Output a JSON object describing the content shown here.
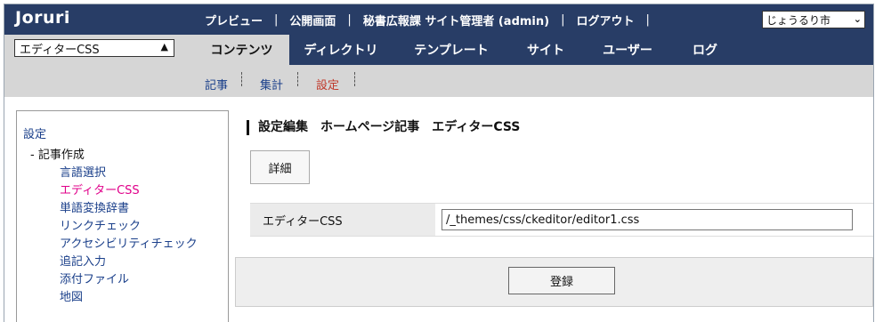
{
  "header": {
    "logo": "Joruri",
    "nav": {
      "preview": "プレビュー",
      "public": "公開画面",
      "user": "秘書広報課 サイト管理者 (admin)",
      "logout": "ログアウト",
      "sep": "|"
    },
    "site_select": "じょうるり市"
  },
  "menu_select": {
    "value": "エディターCSS"
  },
  "tabs": [
    "コンテンツ",
    "ディレクトリ",
    "テンプレート",
    "サイト",
    "ユーザー",
    "ログ"
  ],
  "subnav": [
    "記事",
    "集計",
    "設定"
  ],
  "sidebar": {
    "root": "設定",
    "group": "記事作成",
    "items": [
      "言語選択",
      "エディターCSS",
      "単語変換辞書",
      "リンクチェック",
      "アクセシビリティチェック",
      "追記入力",
      "添付ファイル",
      "地図"
    ]
  },
  "main": {
    "title": "設定編集　ホームページ記事　エディターCSS",
    "detail_button": "詳細",
    "field_label": "エディターCSS",
    "field_value": "/_themes/css/ckeditor/editor1.css",
    "submit_button": "登録"
  },
  "colors": {
    "header_bg": "#283d66",
    "bar_bg": "#d6d6d6",
    "active_side": "#e0008a",
    "active_sub": "#c0392b",
    "link": "#1a3f8a"
  }
}
